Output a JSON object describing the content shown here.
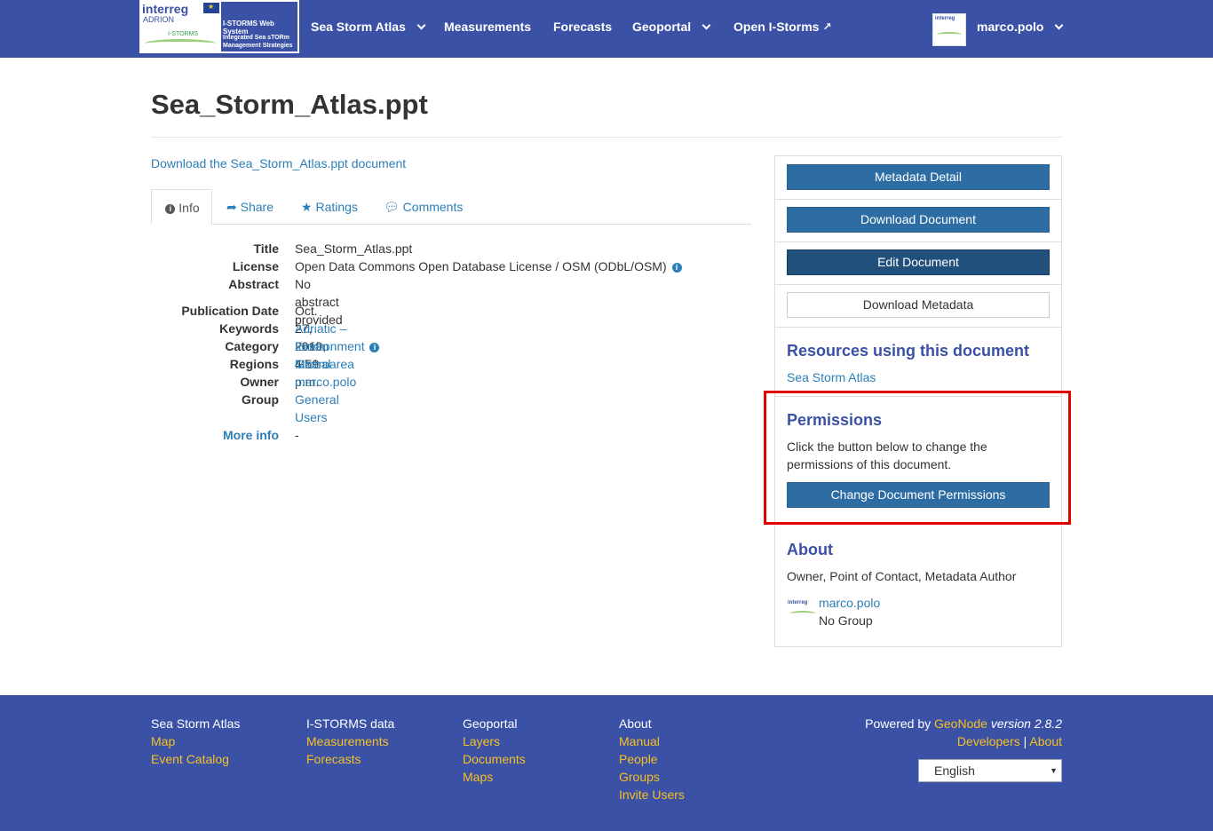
{
  "navbar": {
    "logo": {
      "left_title": "interreg",
      "left_sub": "ADRION",
      "left_brand": "I-STORMS",
      "right_title": "I-STORMS Web System",
      "right_sub": "Integrated Sea sTORm Management Strategies"
    },
    "items": [
      {
        "label": "Sea Storm Atlas",
        "dropdown": true
      },
      {
        "label": "Measurements",
        "dropdown": false
      },
      {
        "label": "Forecasts",
        "dropdown": false
      },
      {
        "label": "Geoportal",
        "dropdown": true
      },
      {
        "label": "Open I-Storms",
        "dropdown": false
      }
    ],
    "user": {
      "name": "marco.polo"
    }
  },
  "page": {
    "title": "Sea_Storm_Atlas.ppt",
    "download_link": "Download the Sea_Storm_Atlas.ppt document"
  },
  "tabs": [
    {
      "label": "Info",
      "icon": "info-icon",
      "active": true
    },
    {
      "label": "Share",
      "icon": "share-icon"
    },
    {
      "label": "Ratings",
      "icon": "star-icon"
    },
    {
      "label": "Comments",
      "icon": "comment-icon"
    }
  ],
  "info": {
    "title": {
      "label": "Title",
      "value": "Sea_Storm_Atlas.ppt"
    },
    "license": {
      "label": "License",
      "value": "Open Data Commons Open Database License / OSM (ODbL/OSM)"
    },
    "abstract": {
      "label": "Abstract",
      "value": "No abstract provided"
    },
    "publication_date": {
      "label": "Publication Date",
      "value": "Oct. 27, 2019, 4:59 p.m."
    },
    "keywords": {
      "label": "Keywords",
      "value": "Adriatic – Ionian Macroarea"
    },
    "category": {
      "label": "Category",
      "value": "Environment"
    },
    "regions": {
      "label": "Regions",
      "value": "Global"
    },
    "owner": {
      "label": "Owner",
      "value": "marco.polo"
    },
    "group": {
      "label": "Group",
      "value": "General Users"
    },
    "more_info": {
      "label": "More info",
      "value": "-"
    }
  },
  "sidebar": {
    "buttons": {
      "metadata_detail": "Metadata Detail",
      "download_document": "Download Document",
      "edit_document": "Edit Document",
      "download_metadata": "Download Metadata"
    },
    "resources": {
      "heading": "Resources using this document",
      "link": "Sea Storm Atlas"
    },
    "permissions": {
      "heading": "Permissions",
      "text": "Click the button below to change the permissions of this document.",
      "button": "Change Document Permissions"
    },
    "about": {
      "heading": "About",
      "roles": "Owner, Point of Contact, Metadata Author",
      "user": "marco.polo",
      "group": "No Group"
    }
  },
  "footer": {
    "columns": [
      {
        "heading": "Sea Storm Atlas",
        "links": [
          "Map",
          "Event Catalog"
        ]
      },
      {
        "heading": "I-STORMS data",
        "links": [
          "Measurements",
          "Forecasts"
        ]
      },
      {
        "heading": "Geoportal",
        "links": [
          "Layers",
          "Documents",
          "Maps"
        ]
      },
      {
        "heading": "About",
        "links": [
          "Manual",
          "People",
          "Groups",
          "Invite Users"
        ]
      }
    ],
    "powered_by": "Powered by",
    "geonode": "GeoNode",
    "version": "version 2.8.2",
    "developers": "Developers",
    "separator": "|",
    "about": "About",
    "language": "English"
  },
  "colors": {
    "navbar": "#3a51a5",
    "link": "#2c7fb8",
    "button": "#2e6da4",
    "footer_link": "#f5c024",
    "highlight": "#e00000"
  }
}
